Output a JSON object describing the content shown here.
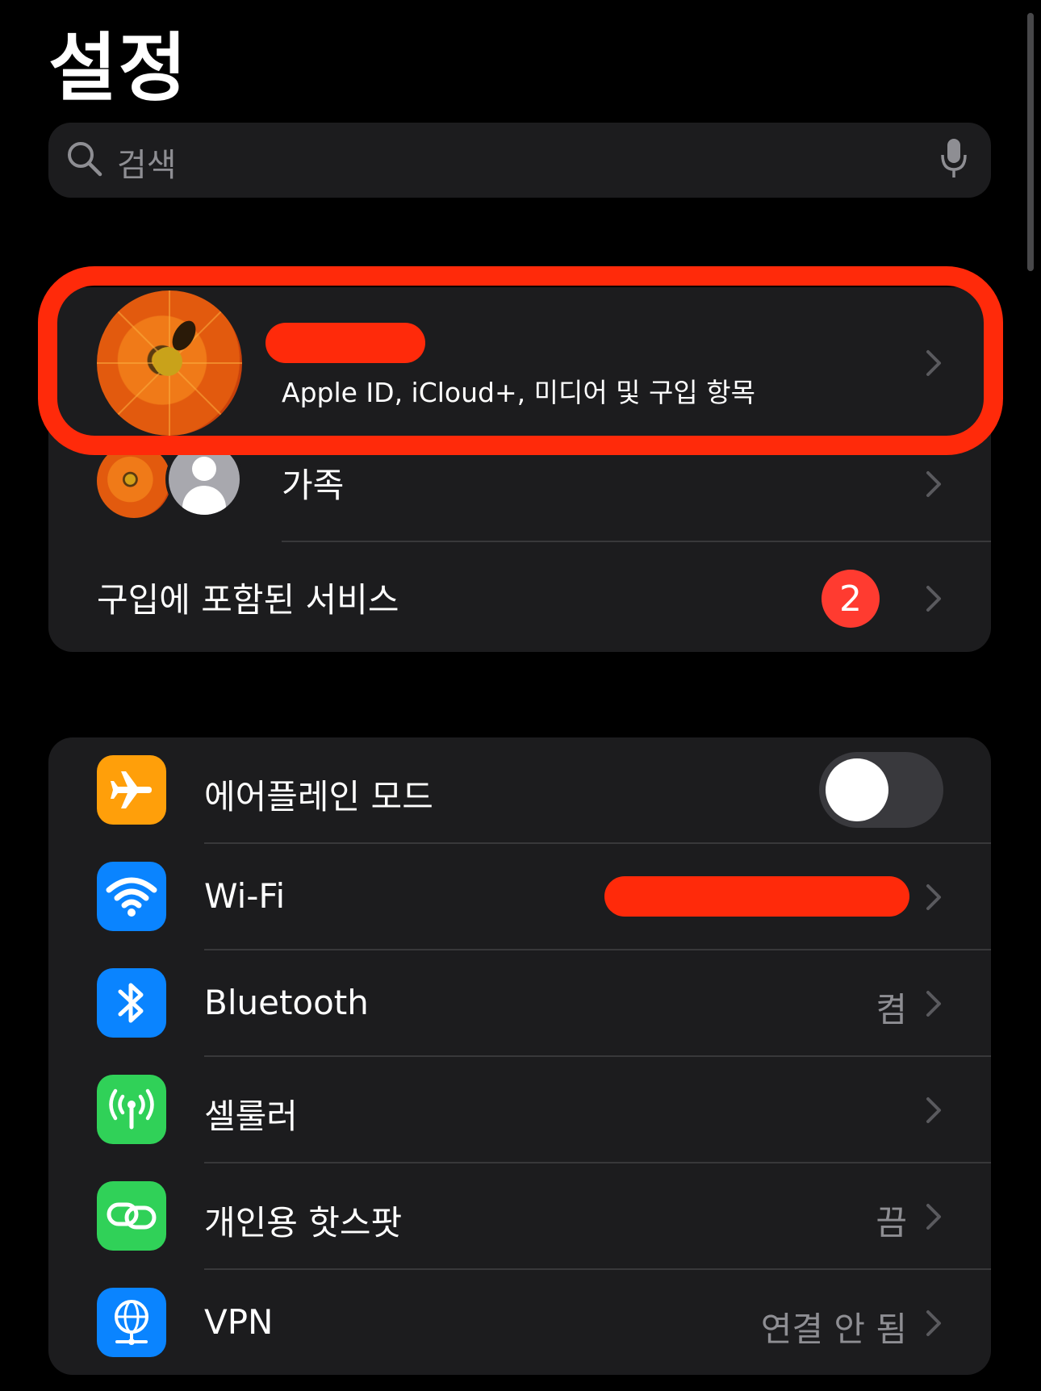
{
  "page_title": "설정",
  "search": {
    "placeholder": "검색"
  },
  "profile": {
    "subtitle": "Apple ID, iCloud+, 미디어 및 구입 항목"
  },
  "family": {
    "label": "가족"
  },
  "services": {
    "label": "구입에 포함된 서비스",
    "badge": "2"
  },
  "settings": [
    {
      "id": "airplane",
      "label": "에어플레인 모드",
      "value": "",
      "icon": "airplane-icon",
      "color": "#ff9f0a",
      "toggle_on": false
    },
    {
      "id": "wifi",
      "label": "Wi-Fi",
      "value": "",
      "icon": "wifi-icon",
      "color": "#0a84ff"
    },
    {
      "id": "bluetooth",
      "label": "Bluetooth",
      "value": "켬",
      "icon": "bluetooth-icon",
      "color": "#0a84ff"
    },
    {
      "id": "cellular",
      "label": "셀룰러",
      "value": "",
      "icon": "cellular-antenna-icon",
      "color": "#30d158"
    },
    {
      "id": "hotspot",
      "label": "개인용 핫스팟",
      "value": "끔",
      "icon": "hotspot-link-icon",
      "color": "#30d158"
    },
    {
      "id": "vpn",
      "label": "VPN",
      "value": "연결 안 됨",
      "icon": "vpn-globe-icon",
      "color": "#0a84ff"
    }
  ],
  "colors": {
    "background": "#000000",
    "card": "#1c1c1e",
    "separator": "#38383a",
    "highlight": "#ff2a0a",
    "badge": "#ff3b30"
  }
}
